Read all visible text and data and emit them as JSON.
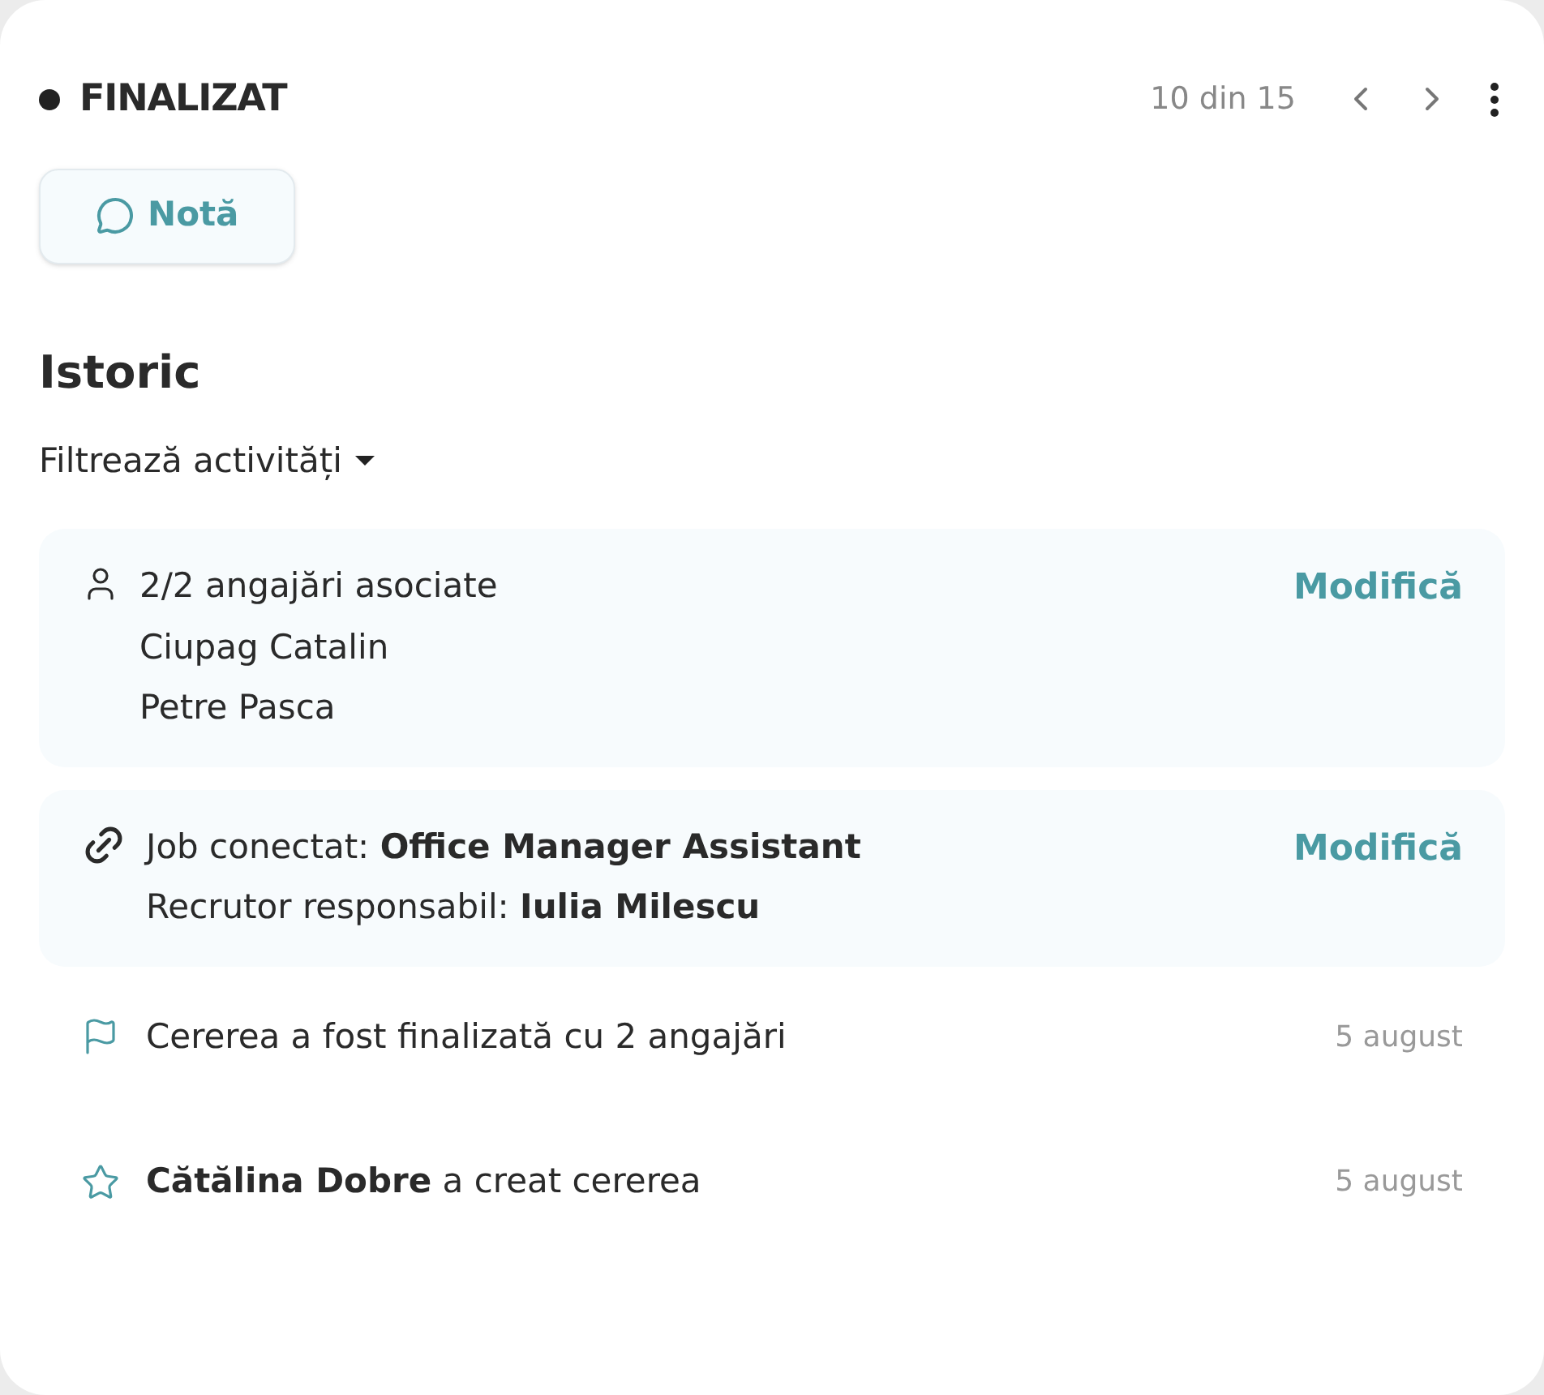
{
  "status": {
    "label": "FINALIZAT"
  },
  "pager": {
    "text": "10 din 15"
  },
  "note_button": {
    "label": "Notă"
  },
  "history": {
    "title": "Istoric",
    "filter": "Filtrează activități"
  },
  "cards": [
    {
      "kind": "employees",
      "summary": "2/2 angajări asociate",
      "lines": [
        "Ciupag Catalin",
        "Petre Pasca"
      ],
      "action": "Modifică"
    },
    {
      "kind": "job",
      "summary": "Job conectat: **Office Manager Assistant**",
      "lines": [
        "Recrutor responsabil: **Iulia Milescu**"
      ],
      "action": "Modifică"
    }
  ],
  "activities": [
    {
      "kind": "flag",
      "text": "Cererea a fost finalizată cu 2 angajări",
      "date": "5 august"
    },
    {
      "kind": "star",
      "text": "**Cătălina Dobre** a creat cererea",
      "date": "5 august"
    }
  ]
}
